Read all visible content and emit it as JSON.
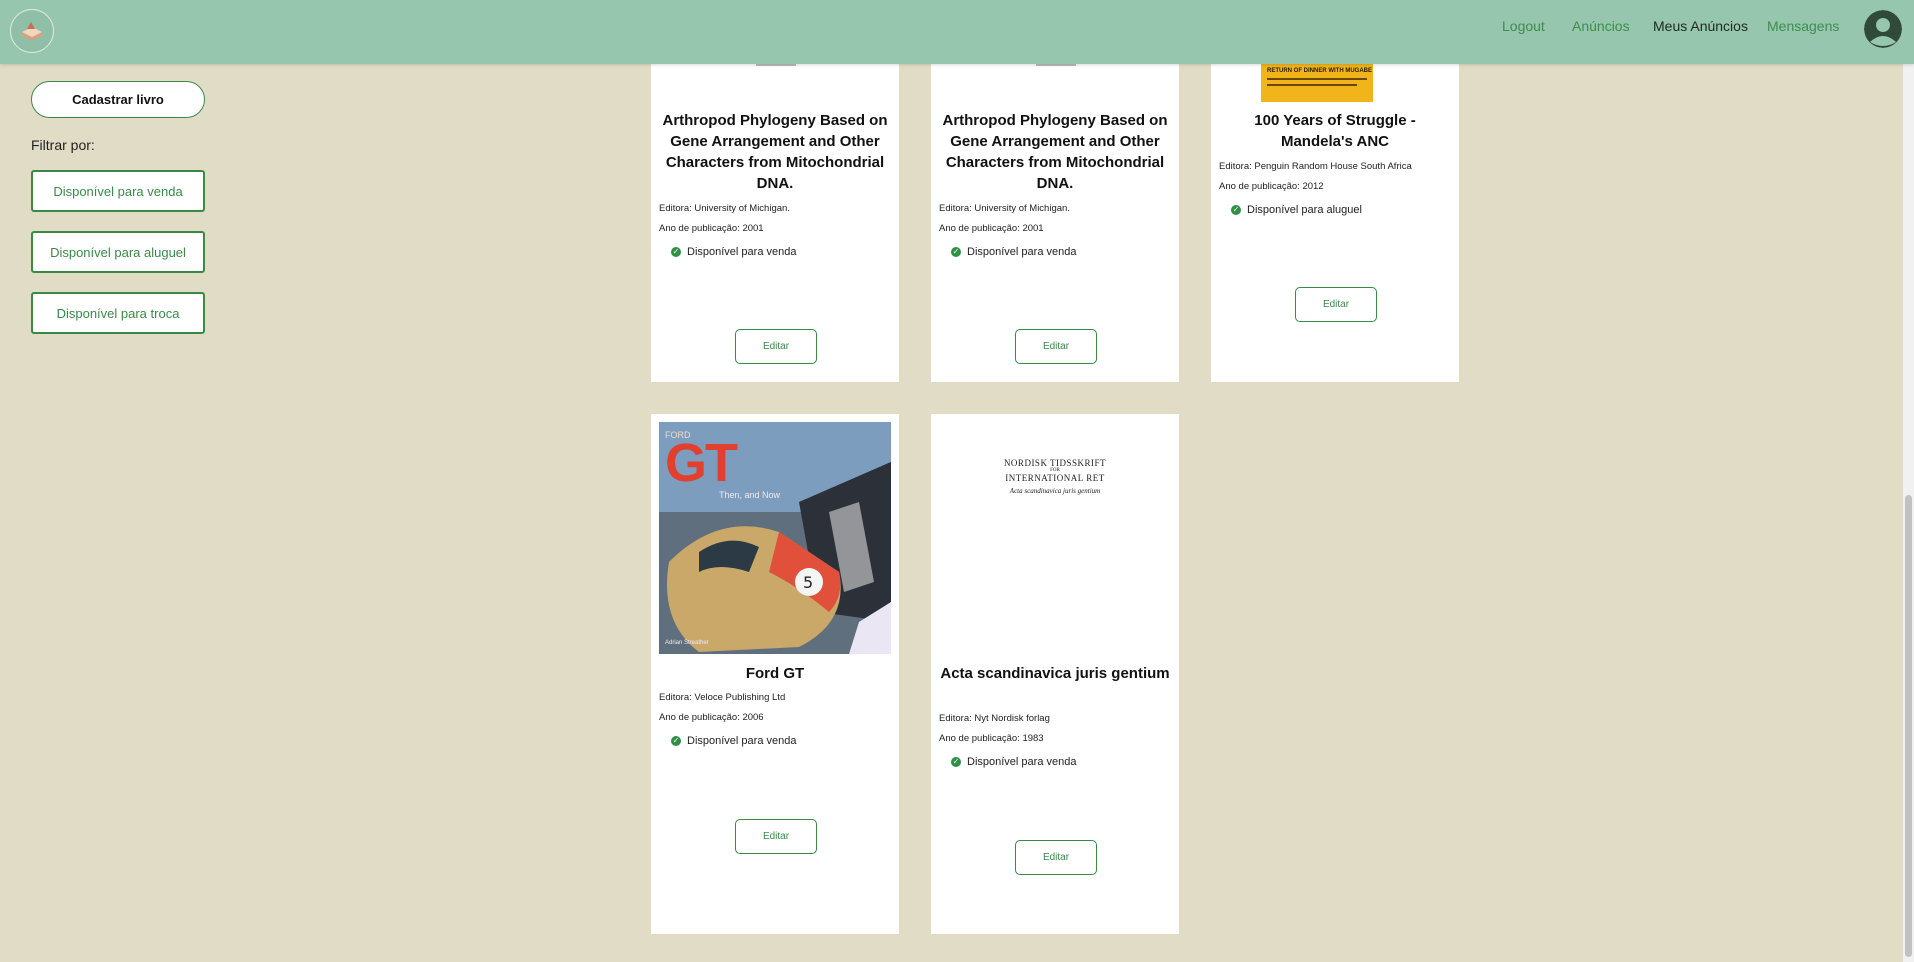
{
  "nav": {
    "logout": "Logout",
    "anuncios": "Anúncios",
    "meus_anuncios": "Meus Anúncios",
    "mensagens": "Mensagens"
  },
  "sidebar": {
    "register_button": "Cadastrar livro",
    "filter_label": "Filtrar por:",
    "filters": [
      "Disponível para venda",
      "Disponível para aluguel",
      "Disponível para troca"
    ]
  },
  "books": [
    {
      "title": "Arthropod Phylogeny Based on Gene Arrangement and Other Characters from Mitochondrial DNA.",
      "publisher": "Editora: University of Michigan.",
      "year": "Ano de publicação: 2001",
      "availability": "Disponível para venda",
      "edit_label": "Editar"
    },
    {
      "title": "Arthropod Phylogeny Based on Gene Arrangement and Other Characters from Mitochondrial DNA.",
      "publisher": "Editora: University of Michigan.",
      "year": "Ano de publicação: 2001",
      "availability": "Disponível para venda",
      "edit_label": "Editar"
    },
    {
      "title": "100 Years of Struggle - Mandela's ANC",
      "publisher": "Editora: Penguin Random House South Africa",
      "year": "Ano de publicação: 2012",
      "availability": "Disponível para aluguel",
      "edit_label": "Editar",
      "cover_text": "RETURN OF DINNER WITH MUGABE"
    },
    {
      "title": "Ford GT",
      "publisher": "Editora: Veloce Publishing Ltd",
      "year": "Ano de publicação: 2006",
      "availability": "Disponível para venda",
      "edit_label": "Editar",
      "cover_text": {
        "brand": "FORD",
        "big": "GT",
        "sub": "Then, and Now",
        "author": "Adrian Streather"
      }
    },
    {
      "title": "Acta scandinavica juris gentium",
      "publisher": "Editora: Nyt Nordisk forlag",
      "year": "Ano de publicação: 1983",
      "availability": "Disponível para venda",
      "edit_label": "Editar",
      "cover_text": {
        "line1": "NORDISK TIDSSKRIFT",
        "line2": "FOR",
        "line3": "INTERNATIONAL RET",
        "line4": "Acta scandinavica juris gentium"
      }
    }
  ],
  "colors": {
    "topbar": "#96c6ae",
    "background": "#e1dcc5",
    "accent_green": "#3a8a47"
  }
}
